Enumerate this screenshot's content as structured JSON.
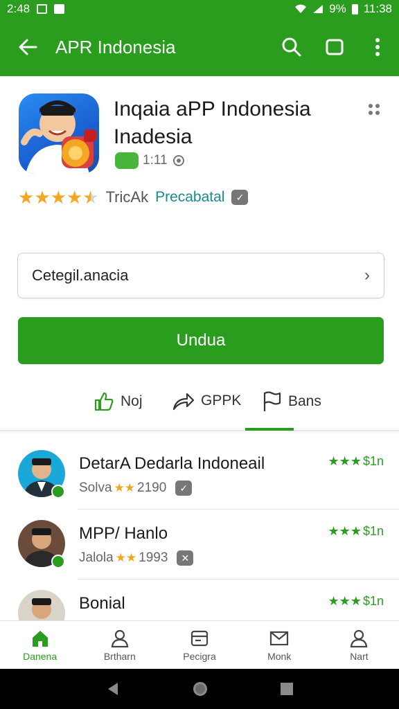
{
  "status_bar": {
    "time_left": "2:48",
    "battery": "9%",
    "time_right": "11:38"
  },
  "app_bar": {
    "title": "APR Indonesia",
    "icons": [
      "back-arrow-icon",
      "search-icon",
      "square-icon",
      "more-vert-icon"
    ]
  },
  "app": {
    "title_line1": "Inqaia aPP Indonesia",
    "title_line2": "Inadesia",
    "version": "1:11",
    "rating_label": "TricAk",
    "rating_link": "Precabatal",
    "rating_stars": 4.5
  },
  "category": {
    "value": "Cetegil.anacia"
  },
  "download_button": {
    "label": "Undua"
  },
  "actions": [
    {
      "label": "Noj",
      "icon": "thumbs-up-icon"
    },
    {
      "label": "GPPK",
      "icon": "share-icon"
    },
    {
      "label": "Bans",
      "icon": "flag-icon"
    }
  ],
  "list": [
    {
      "title": "DetarA Dedarla  Indoneail",
      "sub": "Solva",
      "count": "2190",
      "rating": "$1n"
    },
    {
      "title": "MPP/ Hanlo",
      "sub": "Jalola",
      "count": "1993",
      "rating": "$1n"
    },
    {
      "title": "Bonial",
      "sub": "",
      "count": "",
      "rating": "$1n"
    }
  ],
  "bottom_nav": [
    {
      "label": "Danena",
      "icon": "home-icon",
      "active": true
    },
    {
      "label": "Brtharn",
      "icon": "person-icon",
      "active": false
    },
    {
      "label": "Pecigra",
      "icon": "card-icon",
      "active": false
    },
    {
      "label": "Monk",
      "icon": "mail-icon",
      "active": false
    },
    {
      "label": "Nart",
      "icon": "person-icon",
      "active": false
    }
  ],
  "colors": {
    "brand": "#2a9d1f",
    "star": "#f5a623",
    "link": "#1b8a8a"
  }
}
